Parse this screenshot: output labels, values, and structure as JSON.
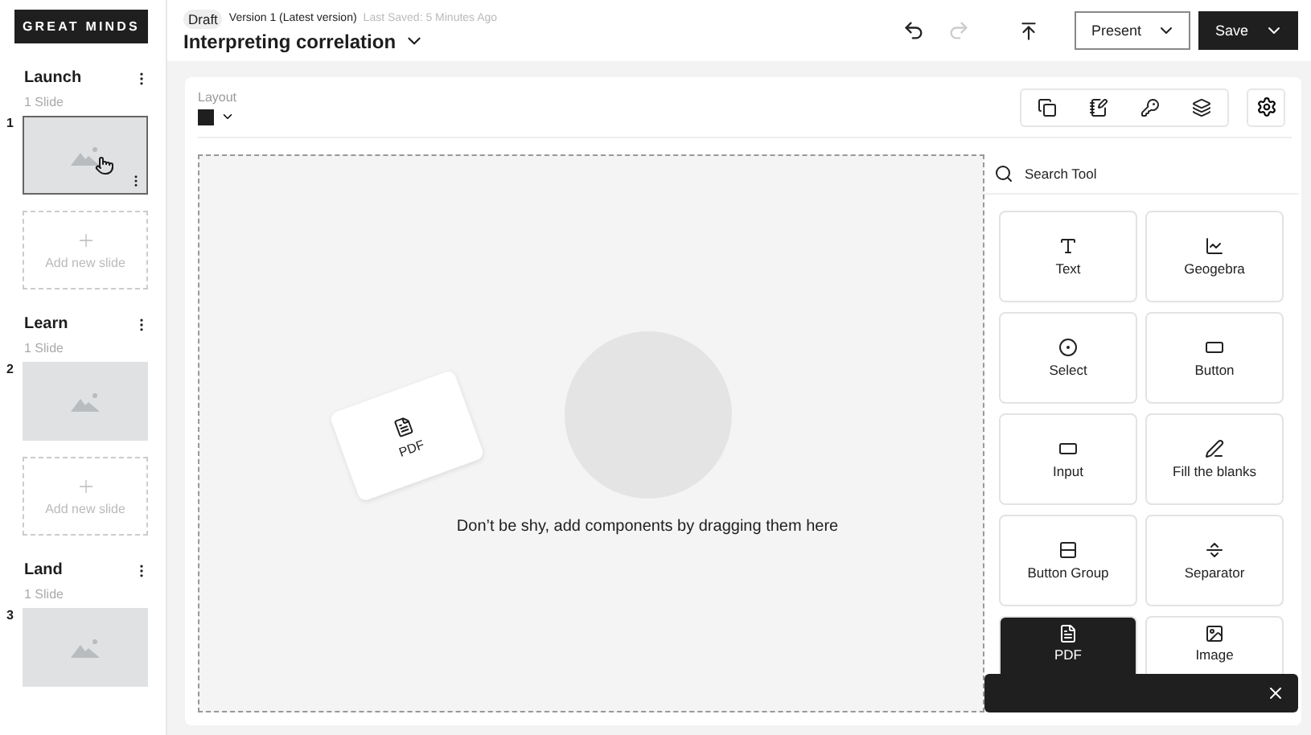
{
  "brand": "GREAT MINDS",
  "sections": [
    {
      "title": "Launch",
      "count": "1 Slide",
      "slides": [
        {
          "number": "1",
          "selected": true
        }
      ],
      "add_label": "Add new slide"
    },
    {
      "title": "Learn",
      "count": "1 Slide",
      "slides": [
        {
          "number": "2",
          "selected": false
        }
      ],
      "add_label": "Add new slide"
    },
    {
      "title": "Land",
      "count": "1 Slide",
      "slides": [
        {
          "number": "3",
          "selected": false
        }
      ]
    }
  ],
  "header": {
    "status": "Draft",
    "version": "Version 1 (Latest version)",
    "saved": "Last Saved: 5 Minutes Ago",
    "title": "Interpreting correlation",
    "redo_disabled": true,
    "present": "Present",
    "save": "Save"
  },
  "layout": {
    "label": "Layout"
  },
  "canvas": {
    "dragged_item": "PDF",
    "hint": "Don’t be shy, add components by dragging them here"
  },
  "tool_panel": {
    "search_placeholder": "Search Tool",
    "tools": [
      {
        "kind": "text",
        "label": "Text",
        "selected": false
      },
      {
        "kind": "geogebra",
        "label": "Geogebra",
        "selected": false
      },
      {
        "kind": "select",
        "label": "Select",
        "selected": false
      },
      {
        "kind": "button",
        "label": "Button",
        "selected": false
      },
      {
        "kind": "input",
        "label": "Input",
        "selected": false
      },
      {
        "kind": "fill_blanks",
        "label": "Fill the blanks",
        "selected": false
      },
      {
        "kind": "button_group",
        "label": "Button Group",
        "selected": false
      },
      {
        "kind": "separator",
        "label": "Separator",
        "selected": false
      },
      {
        "kind": "pdf",
        "label": "PDF",
        "selected": true
      },
      {
        "kind": "image",
        "label": "Image",
        "selected": false
      }
    ]
  }
}
